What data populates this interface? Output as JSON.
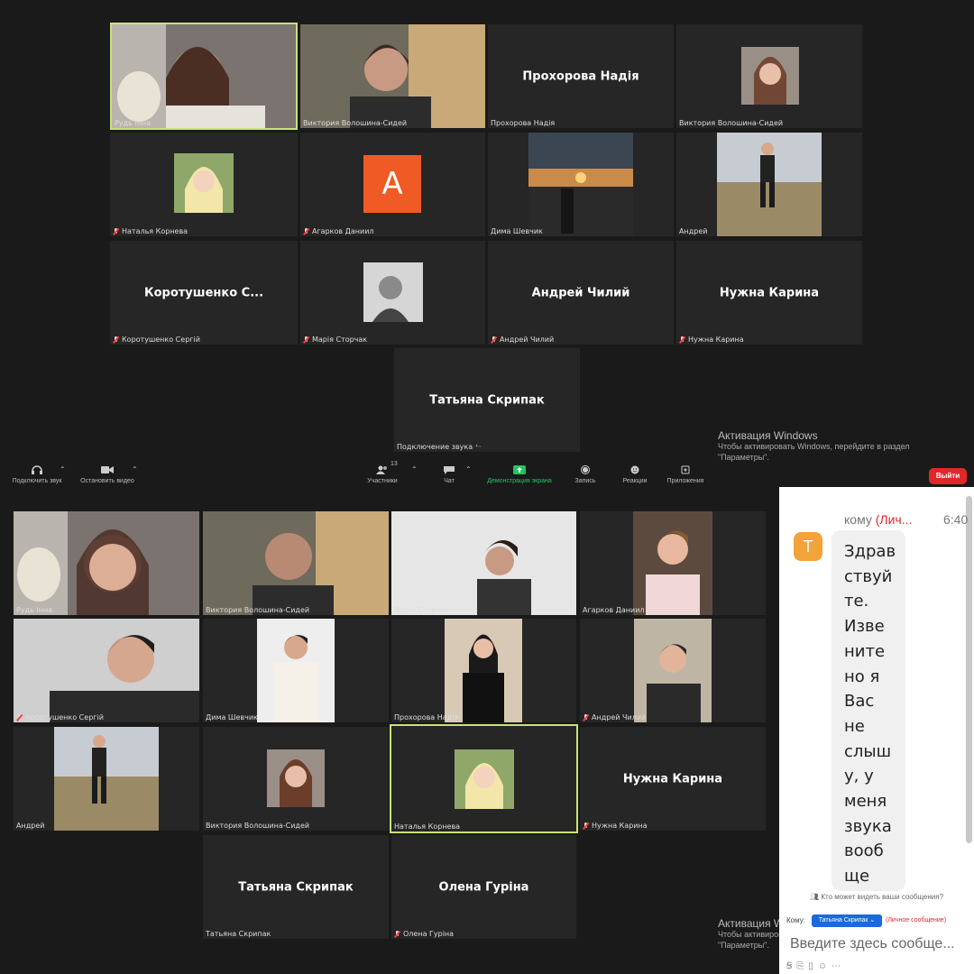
{
  "gallery_top": [
    {
      "label": "Рудь Інна",
      "muted": false,
      "photo": true
    },
    {
      "label": "Виктория Волошина-Сидей",
      "muted": false,
      "photo": true
    },
    {
      "label": "Прохорова Надія",
      "muted": false,
      "bigname": "Прохорова Надія"
    },
    {
      "label": "Виктория Волошина-Сидей",
      "muted": false,
      "photo": true
    },
    {
      "label": "Наталья Корнева",
      "muted": true,
      "photo": true
    },
    {
      "label": "Агарков Даниил",
      "muted": true,
      "avatar": "A"
    },
    {
      "label": "Дима Шевчик",
      "muted": false,
      "photo": true
    },
    {
      "label": "Андрей",
      "muted": false,
      "photo": true
    },
    {
      "label": "Коротушенко Сергій",
      "muted": true,
      "bigname": "Коротушенко  С..."
    },
    {
      "label": "Марія Сторчак",
      "muted": true,
      "photo": true
    },
    {
      "label": "Андрей Чилий",
      "muted": true,
      "bigname": "Андрей Чилий"
    },
    {
      "label": "Нужна Карина",
      "muted": true,
      "bigname": "Нужна Карина"
    },
    {
      "label": "Подключение звука ⁺·",
      "muted": false,
      "bigname": "Татьяна Скрипак"
    }
  ],
  "gallery_bottom": [
    {
      "label": "Рудь Інна",
      "muted": false,
      "photo": true
    },
    {
      "label": "Виктория Волошина-Сидей",
      "muted": false,
      "photo": true
    },
    {
      "label": "Марія Сторчак",
      "muted": false,
      "photo": true
    },
    {
      "label": "Агарков Даниил",
      "muted": false,
      "photo": true
    },
    {
      "label": "Коротушенко Сергій",
      "muted": true,
      "photo": true
    },
    {
      "label": "Дима Шевчик",
      "muted": false,
      "photo": true
    },
    {
      "label": "Прохорова Надія",
      "muted": false,
      "photo": true
    },
    {
      "label": "Андрей Чилий",
      "muted": true,
      "photo": true
    },
    {
      "label": "Андрей",
      "muted": false,
      "photo": true
    },
    {
      "label": "Виктория Волошина-Сидей",
      "muted": false,
      "photo": true
    },
    {
      "label": "Наталья Корнева",
      "muted": false,
      "photo": true
    },
    {
      "label": "Нужна Карина",
      "muted": true,
      "bigname": "Нужна Карина"
    },
    {
      "label": "Татьяна Скрипак",
      "muted": false,
      "bigname": "Татьяна Скрипак"
    },
    {
      "label": "Олена Гуріна",
      "muted": true,
      "bigname": "Олена Гуріна"
    }
  ],
  "toolbar": {
    "audio": "Подключить звук",
    "video": "Остановить видео",
    "participants": "Участники",
    "participants_count": "13",
    "chat": "Чат",
    "share": "Демонстрация экрана",
    "record": "Запись",
    "reactions": "Реакции",
    "apps": "Приложения",
    "exit": "Выйти"
  },
  "windows_activation": {
    "title": "Активация Windows",
    "text": "Чтобы активировать Windows, перейдите в раздел",
    "params": "\"Параметры\".",
    "title_cut": "Активация Windows",
    "text_cut": "Чтобы активировать Windows, перейдите в раздел",
    "params_cut": "\"Параметры\"."
  },
  "chat": {
    "avatar": "T",
    "to": "кому",
    "private": "(Лич...",
    "time": "6:40",
    "message": "Здравствуйте. Извините но я Вас не слышу, у меня звука вообще",
    "message_lines": [
      "Здрав",
      "ствуй",
      "те.",
      "Изве",
      "ните",
      "но я",
      "Вас",
      "не",
      "слыш",
      "у, у",
      "меня",
      "звука",
      "вооб",
      "ще"
    ],
    "who_can_see": "Кто может видеть ваши сообщения?",
    "to_label": "Кому:",
    "recipient": "Татьяна Скрипак",
    "private_tag": "(Личное сообщение)",
    "placeholder": "Введите здесь сообще..."
  },
  "colors": {
    "active_border": "#c8e27a",
    "exit": "#e02828",
    "chat_avatar": "#f2a33a",
    "avatar_a": "#f05a24",
    "share_green": "#22c55e"
  }
}
